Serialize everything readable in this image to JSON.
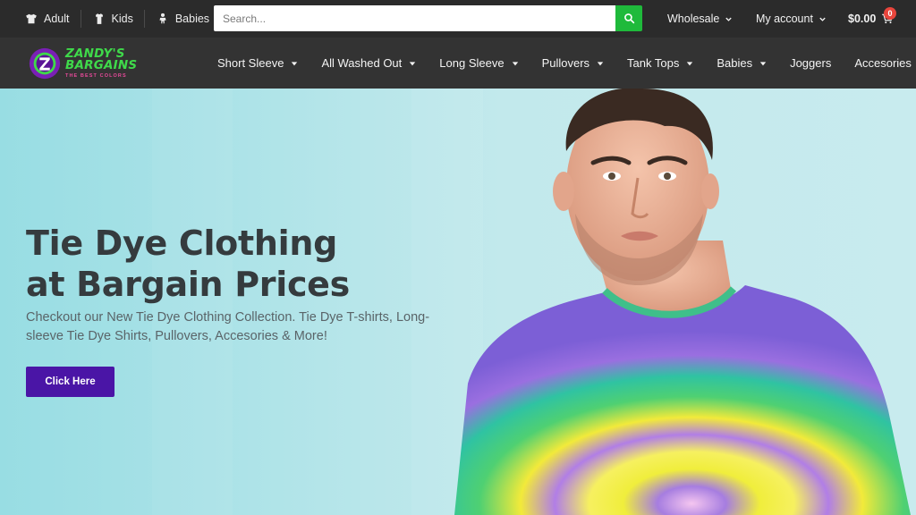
{
  "topbar": {
    "segments": [
      {
        "label": "Adult",
        "icon": "tshirt-icon"
      },
      {
        "label": "Kids",
        "icon": "kid-shirt-icon"
      },
      {
        "label": "Babies",
        "icon": "baby-icon"
      }
    ],
    "search": {
      "placeholder": "Search...",
      "value": "",
      "button_icon": "search-icon",
      "button_color": "#1fba3b"
    },
    "wholesale_label": "Wholesale",
    "account_label": "My account",
    "cart_total": "$0.00",
    "cart_count": "0"
  },
  "brand": {
    "line1": "ZANDY'S",
    "line2": "BARGAINS",
    "tagline": "THE BEST COLORS",
    "mark_letter": "Z",
    "colors": {
      "green": "#3fd94a",
      "purple": "#7a1fb5",
      "pink": "#e84a9a"
    }
  },
  "nav": {
    "items": [
      {
        "label": "Short Sleeve",
        "dropdown": true
      },
      {
        "label": "All Washed Out",
        "dropdown": true
      },
      {
        "label": "Long Sleeve",
        "dropdown": true
      },
      {
        "label": "Pullovers",
        "dropdown": true
      },
      {
        "label": "Tank Tops",
        "dropdown": true
      },
      {
        "label": "Babies",
        "dropdown": true
      },
      {
        "label": "Joggers",
        "dropdown": false
      },
      {
        "label": "Accesories",
        "dropdown": true
      }
    ]
  },
  "hero": {
    "title_line1": "Tie Dye Clothing",
    "title_line2": "at Bargain Prices",
    "subtitle": "Checkout our New Tie Dye Clothing Collection. Tie Dye T-shirts, Long-sleeve Tie Dye Shirts, Pullovers, Accesories & More!",
    "button_label": "Click Here",
    "button_color": "#4a15a6",
    "background_color": "#b8e6ea"
  }
}
